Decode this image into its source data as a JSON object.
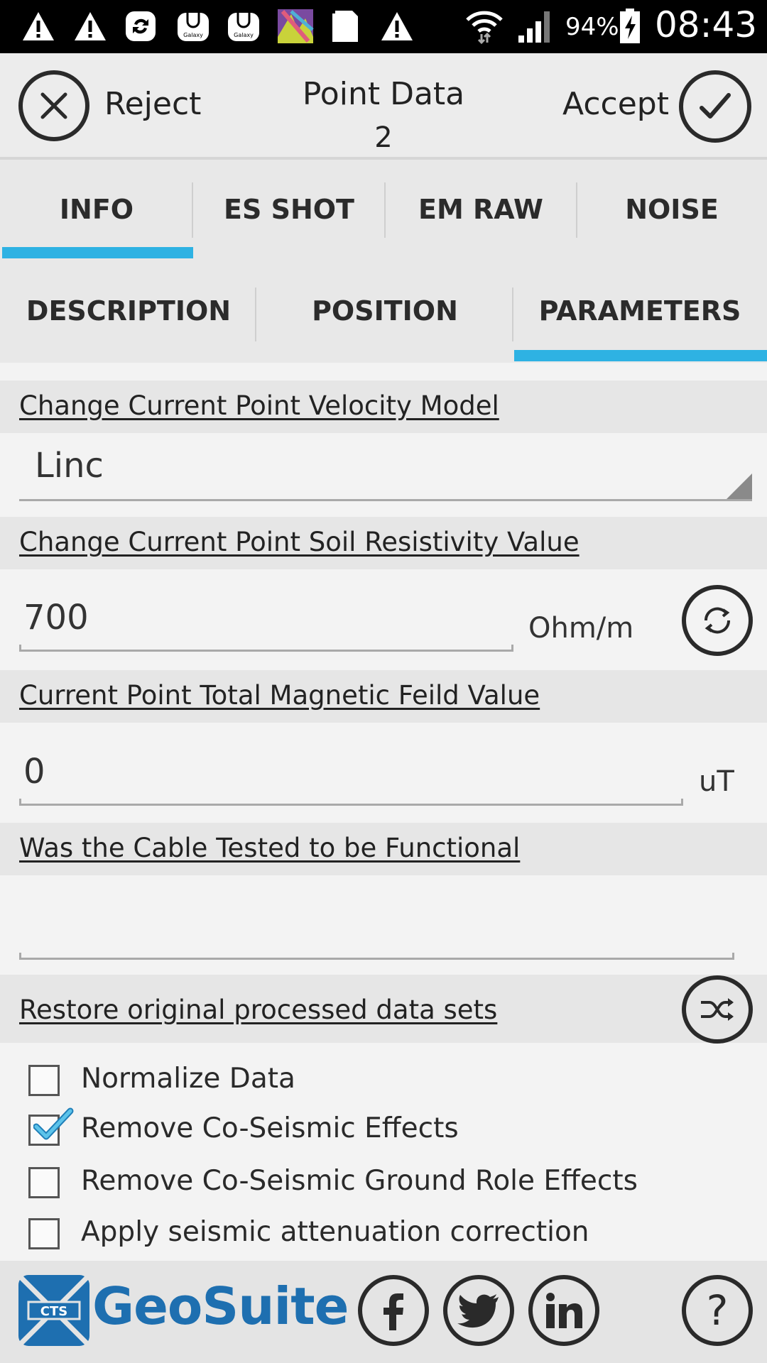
{
  "status_bar": {
    "battery": "94%",
    "time": "08:43",
    "notification_icons": [
      "warning-icon",
      "warning-icon",
      "sync-icon",
      "galaxy-app-icon",
      "galaxy-app-icon",
      "gallery-icon",
      "sim-card-icon",
      "warning-icon"
    ],
    "galaxy_label": "Galaxy"
  },
  "header": {
    "reject_label": "Reject",
    "accept_label": "Accept",
    "title": "Point Data",
    "point_number": "2"
  },
  "tabs_primary": {
    "items": [
      "INFO",
      "ES SHOT",
      "EM RAW",
      "NOISE"
    ],
    "selected": "INFO"
  },
  "tabs_secondary": {
    "items": [
      "DESCRIPTION",
      "POSITION",
      "PARAMETERS"
    ],
    "selected": "PARAMETERS"
  },
  "velocity": {
    "heading": "Change Current Point Velocity Model",
    "selected": "Linc"
  },
  "resistivity": {
    "heading": "Change Current Point Soil Resistivity Value",
    "value": "700",
    "unit": "Ohm/m"
  },
  "magnetic": {
    "heading": "Current Point Total Magnetic Feild Value",
    "value": "0",
    "unit": "uT"
  },
  "cable": {
    "heading": "Was the Cable Tested to be Functional",
    "value": ""
  },
  "restore": {
    "heading": "Restore original processed data sets"
  },
  "options": [
    {
      "label": "Normalize Data",
      "checked": false
    },
    {
      "label": "Remove Co-Seismic Effects",
      "checked": true
    },
    {
      "label": "Remove Co-Seismic Ground Role Effects",
      "checked": false
    },
    {
      "label": "Apply seismic attenuation correction",
      "checked": false
    }
  ],
  "footer": {
    "brand": "GeoSuite",
    "logo_text": "CTS",
    "social": [
      "facebook-icon",
      "twitter-icon",
      "linkedin-icon"
    ],
    "accent": "#2eb2e3",
    "brand_blue": "#1e6fb0"
  }
}
